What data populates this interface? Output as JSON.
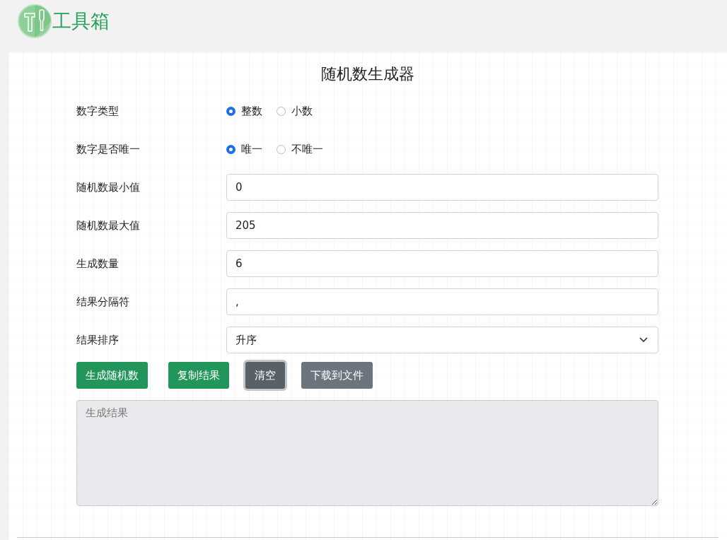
{
  "header": {
    "logo_text": "工具箱"
  },
  "title": "随机数生成器",
  "fields": [
    {
      "kind": "radio",
      "label": "数字类型",
      "options": [
        {
          "label": "整数",
          "selected": true
        },
        {
          "label": "小数",
          "selected": false
        }
      ]
    },
    {
      "kind": "radio",
      "label": "数字是否唯一",
      "options": [
        {
          "label": "唯一",
          "selected": true
        },
        {
          "label": "不唯一",
          "selected": false
        }
      ]
    },
    {
      "kind": "text",
      "label": "随机数最小值",
      "value": "0"
    },
    {
      "kind": "text",
      "label": "随机数最大值",
      "value": "205"
    },
    {
      "kind": "text",
      "label": "生成数量",
      "value": "6"
    },
    {
      "kind": "text",
      "label": "结果分隔符",
      "value": ","
    },
    {
      "kind": "select",
      "label": "结果排序",
      "value": "升序"
    }
  ],
  "buttons": [
    {
      "label": "生成随机数",
      "kind": "primary",
      "focused": false
    },
    {
      "label": "复制结果",
      "kind": "primary",
      "focused": false
    },
    {
      "label": "清空",
      "kind": "secondary",
      "focused": true
    },
    {
      "label": "下载到文件",
      "kind": "secondary",
      "focused": false
    }
  ],
  "result": {
    "placeholder": "生成结果",
    "disabled": true
  }
}
